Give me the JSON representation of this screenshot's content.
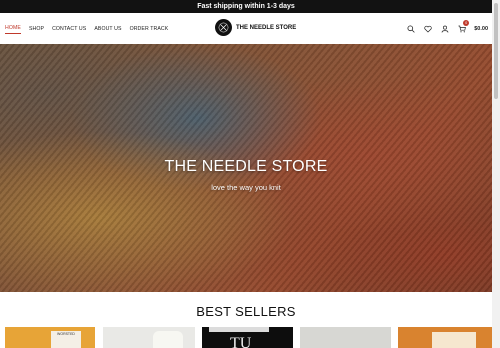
{
  "announcement": {
    "text": "Fast shipping within 1-3 days"
  },
  "nav": {
    "items": [
      {
        "label": "HOME",
        "active": true
      },
      {
        "label": "SHOP",
        "active": false
      },
      {
        "label": "CONTACT US",
        "active": false
      },
      {
        "label": "ABOUT US",
        "active": false
      },
      {
        "label": "ORDER TRACK",
        "active": false
      }
    ]
  },
  "logo": {
    "name": "THE NEEDLE STORE"
  },
  "header_icons": {
    "search": "search-icon",
    "wishlist": "heart-icon",
    "account": "user-icon",
    "cart": "cart-icon",
    "cart_count": "0",
    "cart_total": "$0.00"
  },
  "hero": {
    "title": "THE NEEDLE STORE",
    "subtitle": "love the way you knit"
  },
  "best_sellers": {
    "title": "BEST SELLERS",
    "card_texts": {
      "card1": "WORSTED",
      "card3": "TU"
    }
  },
  "colors": {
    "accent": "#c0392b",
    "topbar": "#121212"
  }
}
